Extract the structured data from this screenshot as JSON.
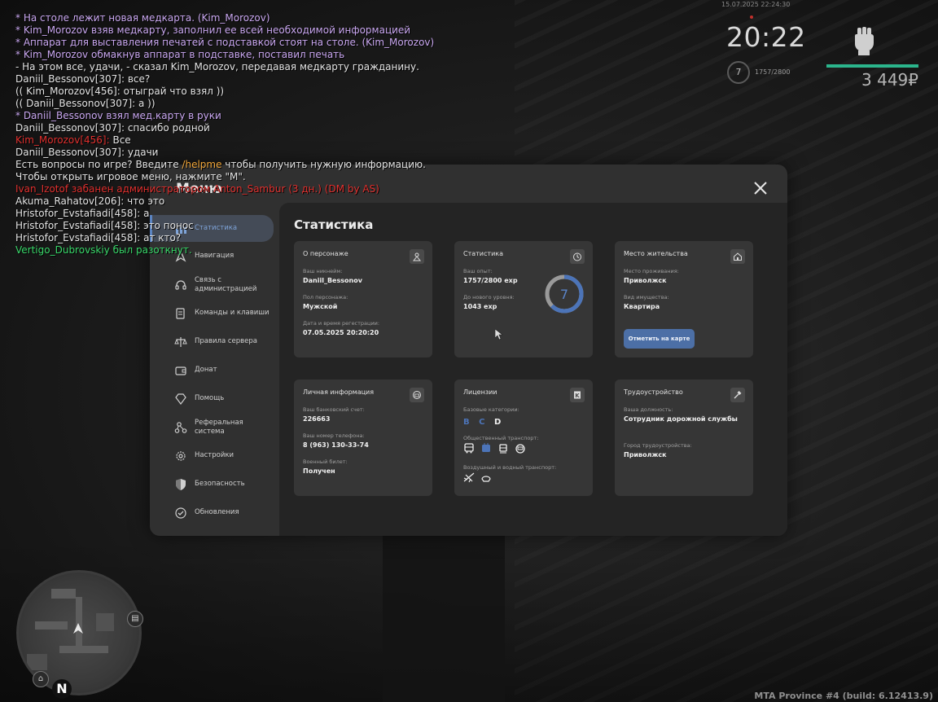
{
  "chat": [
    {
      "parts": [
        {
          "t": "* На столе лежит новая медкарта. (Kim_Morozov)",
          "c": "c-purple"
        }
      ]
    },
    {
      "parts": [
        {
          "t": "* Kim_Morozov взяв медкарту, заполнил ее всей необходимой информацией",
          "c": "c-purple"
        }
      ]
    },
    {
      "parts": [
        {
          "t": "* Аппарат для выставления печатей с подставкой стоят на столе. (Kim_Morozov)",
          "c": "c-purple"
        }
      ]
    },
    {
      "parts": [
        {
          "t": "* Kim_Morozov обмакнув аппарат в подставке, поставил печать",
          "c": "c-purple"
        }
      ]
    },
    {
      "parts": [
        {
          "t": "- На этом все, удачи, - сказал Kim_Morozov, передавая медкарту гражданину.",
          "c": "c-white"
        }
      ]
    },
    {
      "parts": [
        {
          "t": "Daniil_Bessonov[307]: все?",
          "c": "c-white"
        }
      ]
    },
    {
      "parts": [
        {
          "t": "(( Kim_Morozov[456]: отыграй что взял ))",
          "c": "c-white"
        }
      ]
    },
    {
      "parts": [
        {
          "t": "(( Daniil_Bessonov[307]: а ))",
          "c": "c-white"
        }
      ]
    },
    {
      "parts": [
        {
          "t": "* Daniil_Bessonov взял мед.карту в руки",
          "c": "c-purple"
        }
      ]
    },
    {
      "parts": [
        {
          "t": "Daniil_Bessonov[307]: спасибо родной",
          "c": "c-white"
        }
      ]
    },
    {
      "parts": [
        {
          "t": "Kim_Morozov[456]:",
          "c": "c-red"
        },
        {
          "t": " Все",
          "c": "c-white"
        }
      ]
    },
    {
      "parts": [
        {
          "t": "Daniil_Bessonov[307]: удачи",
          "c": "c-white"
        }
      ]
    },
    {
      "parts": [
        {
          "t": "Есть вопросы по игре? Введите ",
          "c": "c-white"
        },
        {
          "t": "/helpme",
          "c": "c-orange"
        },
        {
          "t": " чтобы получить нужную информацию.",
          "c": "c-white"
        }
      ]
    },
    {
      "parts": [
        {
          "t": "Чтобы открыть игровое меню, нажмите \"M\".",
          "c": "c-white"
        }
      ]
    },
    {
      "parts": [
        {
          "t": "Ivan_Izotof забанен администратором Anton_Sambur (3 дн.) (DM by AS)",
          "c": "c-red"
        }
      ]
    },
    {
      "parts": [
        {
          "t": "Akuma_Rahatov[206]: что это",
          "c": "c-white"
        }
      ]
    },
    {
      "parts": [
        {
          "t": "Hristofor_Evstafiadi[458]: а",
          "c": "c-white"
        }
      ]
    },
    {
      "parts": [
        {
          "t": "Hristofor_Evstafiadi[458]: это понос",
          "c": "c-white"
        }
      ]
    },
    {
      "parts": [
        {
          "t": "Hristofor_Evstafiadi[458]: ат кто?",
          "c": "c-white"
        }
      ]
    },
    {
      "parts": [
        {
          "t": "Vertigo_Dubrovskiy был разоткнут.",
          "c": "c-green"
        }
      ]
    }
  ],
  "hud": {
    "date": "15.07.2025 22:24:30",
    "time": "20:22",
    "level": "7",
    "exp": "1757/2800",
    "money": "3 449₽",
    "health_fraction": 1.0
  },
  "minimap": {
    "north": "N",
    "build": "MTA Province #4 (build: 6.12413.9)"
  },
  "menu": {
    "title": "Меню",
    "sidebar": [
      {
        "label": "Статистика",
        "icon": "stats-icon",
        "active": true
      },
      {
        "label": "Навигация",
        "icon": "navigation-icon"
      },
      {
        "label": "Связь с администрацией",
        "icon": "headset-icon"
      },
      {
        "label": "Команды и клавиши",
        "icon": "keyboard-icon"
      },
      {
        "label": "Правила сервера",
        "icon": "rules-icon"
      },
      {
        "label": "Донат",
        "icon": "wallet-icon"
      },
      {
        "label": "Помощь",
        "icon": "help-icon"
      },
      {
        "label": "Реферальная система",
        "icon": "referral-icon"
      },
      {
        "label": "Настройки",
        "icon": "settings-icon"
      },
      {
        "label": "Безопасность",
        "icon": "shield-icon"
      },
      {
        "label": "Обновления",
        "icon": "updates-icon"
      }
    ],
    "content_title": "Статистика",
    "cards": {
      "character": {
        "title": "О персонаже",
        "nick_label": "Ваш никнейм:",
        "nick": "Daniil_Bessonov",
        "gender_label": "Пол персонажа:",
        "gender": "Мужской",
        "reg_label": "Дата и время регестрации:",
        "reg": "07.05.2025 20:20:20"
      },
      "stats": {
        "title": "Статистика",
        "exp_label": "Ваш опыт:",
        "exp": "1757/2800 exp",
        "next_label": "До нового уровня:",
        "next": "1043 exp",
        "level": "7",
        "progress": 0.6275
      },
      "residence": {
        "title": "Место жительства",
        "place_label": "Место проживания:",
        "place": "Приволжск",
        "property_label": "Вид имущества:",
        "property": "Квартира",
        "map_button": "Отметить на карте"
      },
      "personal": {
        "title": "Личная информация",
        "bank_label": "Ваш банковский счет:",
        "bank": "226663",
        "phone_label": "Ваш номер телефона:",
        "phone": "8 (963) 130-33-74",
        "military_label": "Военный билет:",
        "military": "Получен"
      },
      "licenses": {
        "title": "Лицензии",
        "base_label": "Базовые категории:",
        "categories": [
          {
            "letter": "B",
            "color": "#4c74b8"
          },
          {
            "letter": "C",
            "color": "#4c74b8"
          },
          {
            "letter": "D",
            "color": "#f0f0f0"
          }
        ],
        "public_label": "Общественный транспорт:",
        "air_label": "Воздушный и водный транспорт:"
      },
      "job": {
        "title": "Трудоустройство",
        "position_label": "Ваша должность:",
        "position": "Сотрудник дорожной службы",
        "city_label": "Город трудоустройства:",
        "city": "Приволжск"
      }
    }
  }
}
